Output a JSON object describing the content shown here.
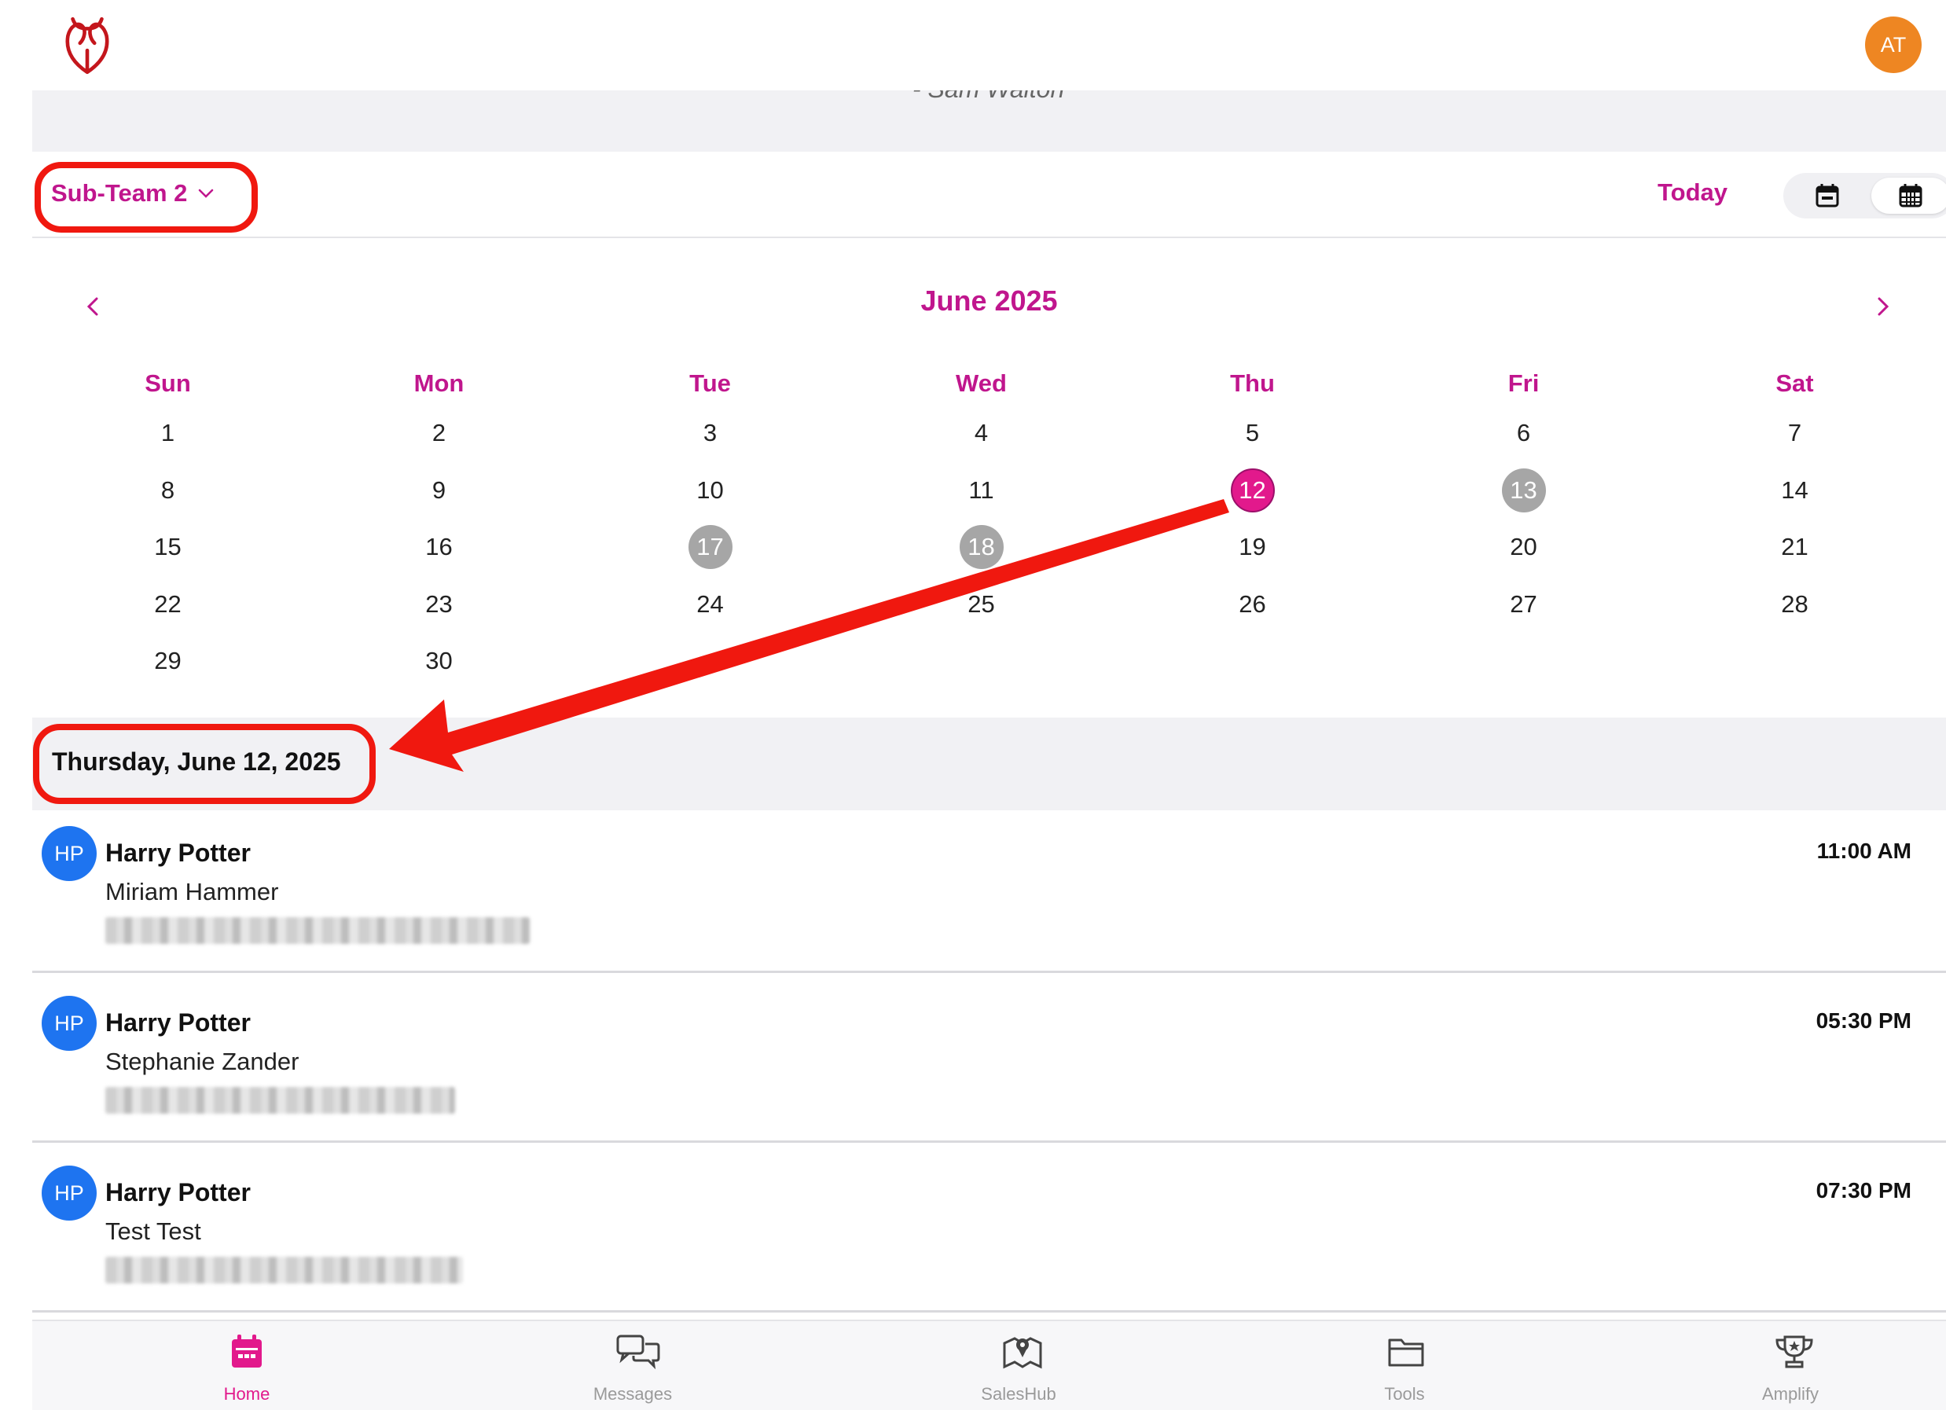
{
  "header": {
    "avatar_initials": "AT",
    "quote_attribution": "- Sam Walton"
  },
  "filter": {
    "team": "Sub-Team 2",
    "today_label": "Today",
    "active_view": "month"
  },
  "calendar": {
    "month_title": "June 2025",
    "weekdays": [
      "Sun",
      "Mon",
      "Tue",
      "Wed",
      "Thu",
      "Fri",
      "Sat"
    ],
    "weeks": [
      [
        "1",
        "2",
        "3",
        "4",
        "5",
        "6",
        "7"
      ],
      [
        "8",
        "9",
        "10",
        "11",
        "12",
        "13",
        "14"
      ],
      [
        "15",
        "16",
        "17",
        "18",
        "19",
        "20",
        "21"
      ],
      [
        "22",
        "23",
        "24",
        "25",
        "26",
        "27",
        "28"
      ],
      [
        "29",
        "30",
        "",
        "",
        "",
        "",
        ""
      ]
    ],
    "selected_day": "12",
    "event_days": [
      "13",
      "17",
      "18"
    ]
  },
  "agenda": {
    "date_heading": "Thursday, June 12, 2025",
    "appointments": [
      {
        "initials": "HP",
        "name": "Harry Potter",
        "contact": "Miriam Hammer",
        "time": "11:00 AM"
      },
      {
        "initials": "HP",
        "name": "Harry Potter",
        "contact": "Stephanie Zander",
        "time": "05:30 PM"
      },
      {
        "initials": "HP",
        "name": "Harry Potter",
        "contact": "Test Test",
        "time": "07:30 PM"
      }
    ]
  },
  "tabs": [
    {
      "label": "Home",
      "icon": "calendar-icon",
      "active": true
    },
    {
      "label": "Messages",
      "icon": "chat-icon",
      "active": false
    },
    {
      "label": "SalesHub",
      "icon": "map-pin-icon",
      "active": false
    },
    {
      "label": "Tools",
      "icon": "folder-icon",
      "active": false
    },
    {
      "label": "Amplify",
      "icon": "trophy-icon",
      "active": false
    }
  ],
  "colors": {
    "accent": "#C0168D",
    "selected_day": "#E2198C",
    "event_day": "#A6A6A6",
    "avatar_user": "#EE8622",
    "avatar_attendee": "#1E74F0",
    "annotation": "#F0180F"
  }
}
